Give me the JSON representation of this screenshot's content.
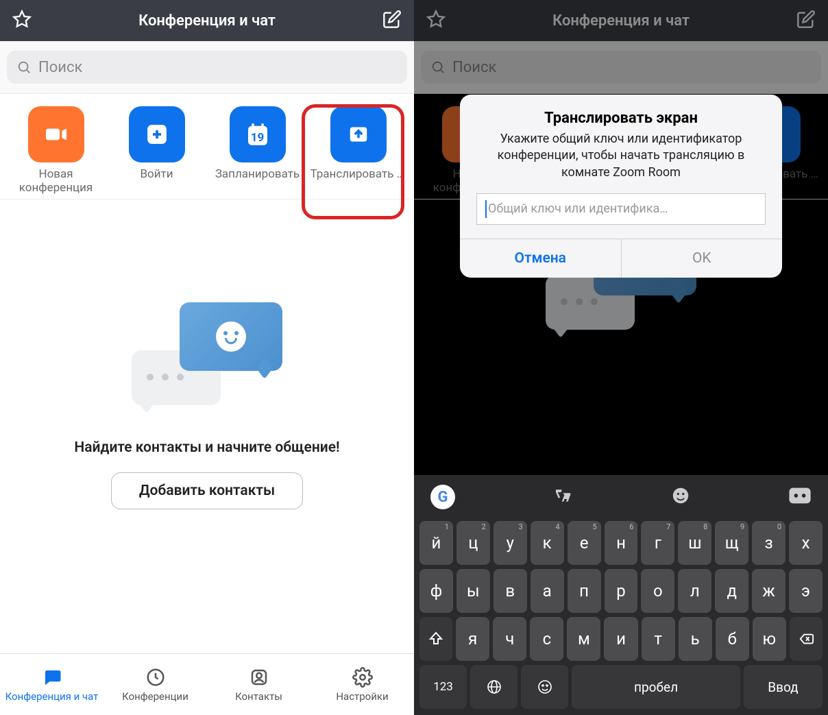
{
  "header": {
    "title": "Конференция и чат"
  },
  "search": {
    "placeholder": "Поиск"
  },
  "actions": {
    "new_meeting": "Новая конференция",
    "join": "Войти",
    "schedule": "Запланировать",
    "schedule_day": "19",
    "share": "Транслировать э..."
  },
  "empty": {
    "message": "Найдите контакты и начните общение!",
    "button": "Добавить контакты"
  },
  "tabs": {
    "chat": "Конференция и чат",
    "meetings": "Конференции",
    "contacts": "Контакты",
    "settings": "Настройки"
  },
  "dialog": {
    "title": "Транслировать экран",
    "description": "Укажите общий ключ или идентификатор конференции, чтобы начать трансляцию в комнате Zoom Room",
    "placeholder": "Общий ключ или идентифика…",
    "cancel": "Отмена",
    "ok": "OK"
  },
  "keyboard": {
    "row1": [
      {
        "main": "й",
        "hint": "1"
      },
      {
        "main": "ц",
        "hint": "2"
      },
      {
        "main": "у",
        "hint": "3"
      },
      {
        "main": "к",
        "hint": "4"
      },
      {
        "main": "е",
        "hint": "5"
      },
      {
        "main": "н",
        "hint": "6"
      },
      {
        "main": "г",
        "hint": "7"
      },
      {
        "main": "ш",
        "hint": "8"
      },
      {
        "main": "щ",
        "hint": "9"
      },
      {
        "main": "з",
        "hint": "0"
      },
      {
        "main": "х",
        "hint": ""
      }
    ],
    "row2": [
      "ф",
      "ы",
      "в",
      "а",
      "п",
      "р",
      "о",
      "л",
      "д",
      "ж",
      "э"
    ],
    "row3": [
      "я",
      "ч",
      "с",
      "м",
      "и",
      "т",
      "ь",
      "б",
      "ю"
    ],
    "num_label": "123",
    "space": "пробел",
    "enter": "Ввод",
    "google_g": "G"
  }
}
